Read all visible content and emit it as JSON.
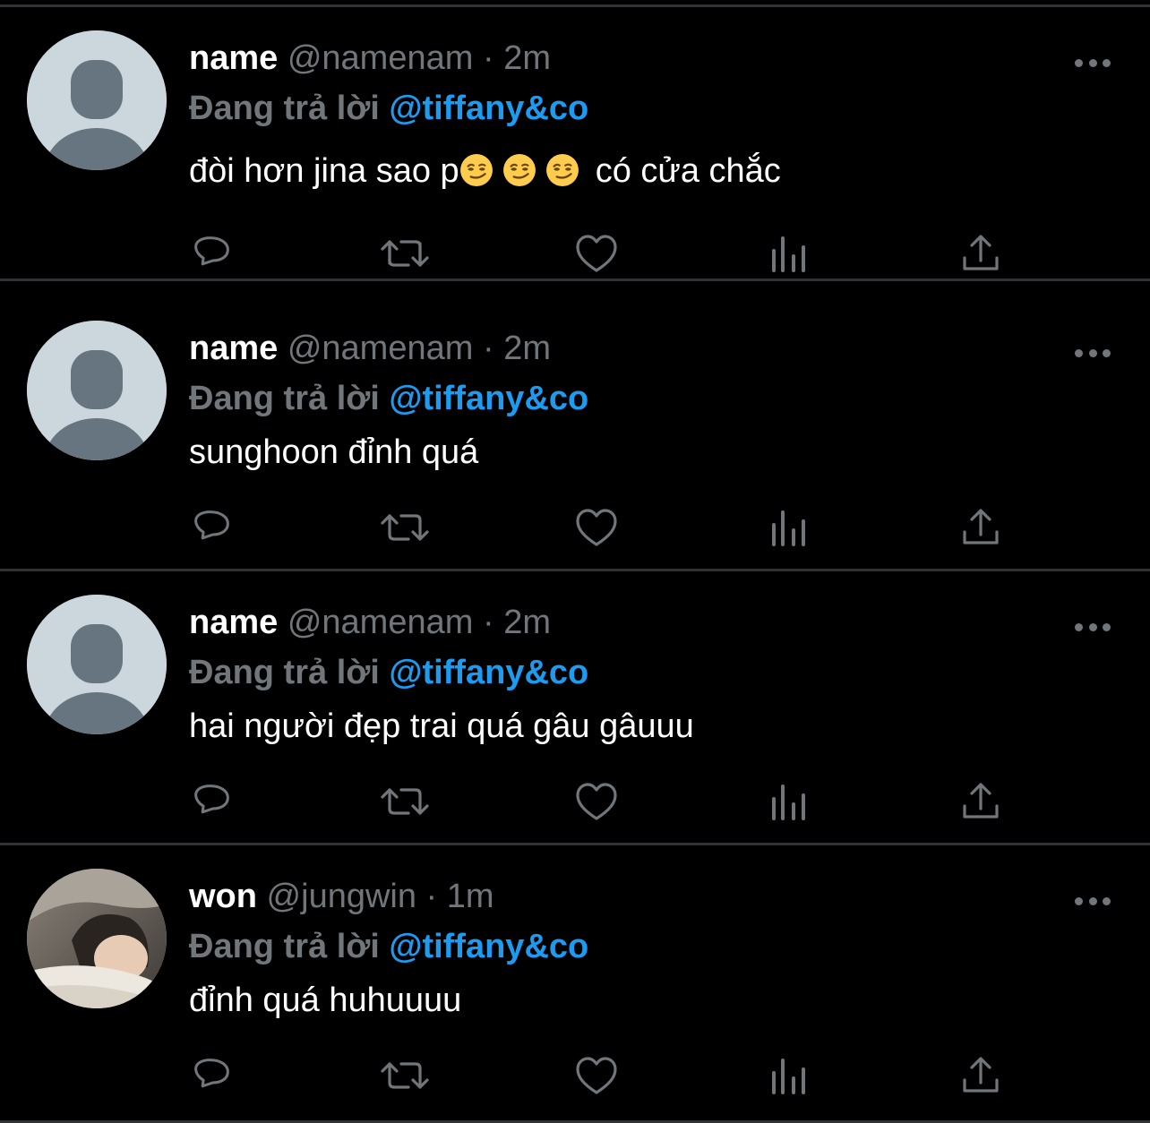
{
  "tweets": [
    {
      "display_name": "name",
      "handle": "@namenam",
      "separator": "·",
      "time": "2m",
      "reply_label": "Đang trả lời",
      "reply_mention": "@tiffany&co",
      "text_before": "đòi hơn jina sao p",
      "emojis": [
        "smirking-face-emoji",
        "smirking-face-emoji",
        "smirking-face-emoji"
      ],
      "text_after": "có cửa chắc",
      "avatar": "default-avatar"
    },
    {
      "display_name": "name",
      "handle": "@namenam",
      "separator": "·",
      "time": "2m",
      "reply_label": "Đang trả lời",
      "reply_mention": "@tiffany&co",
      "text": "sunghoon đỉnh quá",
      "avatar": "default-avatar"
    },
    {
      "display_name": "name",
      "handle": "@namenam",
      "separator": "·",
      "time": "2m",
      "reply_label": "Đang trả lời",
      "reply_mention": "@tiffany&co",
      "text": "hai người đẹp trai quá gâu gâuuu",
      "avatar": "default-avatar"
    },
    {
      "display_name": "won",
      "handle": "@jungwin",
      "separator": "·",
      "time": "1m",
      "reply_label": "Đang trả lời",
      "reply_mention": "@tiffany&co",
      "text": "đỉnh quá huhuuuu",
      "avatar": "photo-avatar"
    }
  ],
  "icons": {
    "reply": "reply-icon",
    "retweet": "retweet-icon",
    "like": "like-icon",
    "views": "views-icon",
    "share": "share-icon",
    "more": "more-icon"
  },
  "colors": {
    "background": "#000000",
    "divider": "#2f3336",
    "muted": "#71767b",
    "accent": "#1d9bf0",
    "text": "#ffffff"
  }
}
